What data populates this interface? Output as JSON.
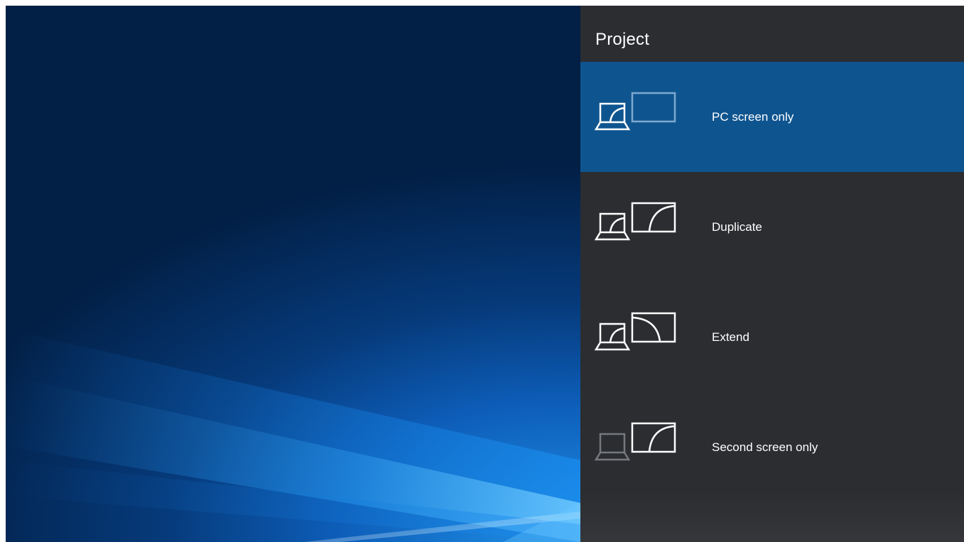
{
  "flyout": {
    "title": "Project",
    "options": [
      {
        "label": "PC screen only",
        "selected": true
      },
      {
        "label": "Duplicate",
        "selected": false
      },
      {
        "label": "Extend",
        "selected": false
      },
      {
        "label": "Second screen only",
        "selected": false
      }
    ]
  },
  "colors": {
    "panel_background": "#2b2d31",
    "selected_background": "#0e5590",
    "text": "#ffffff"
  },
  "icons": [
    "pc-screen-only-icon",
    "duplicate-icon",
    "extend-icon",
    "second-screen-only-icon"
  ]
}
